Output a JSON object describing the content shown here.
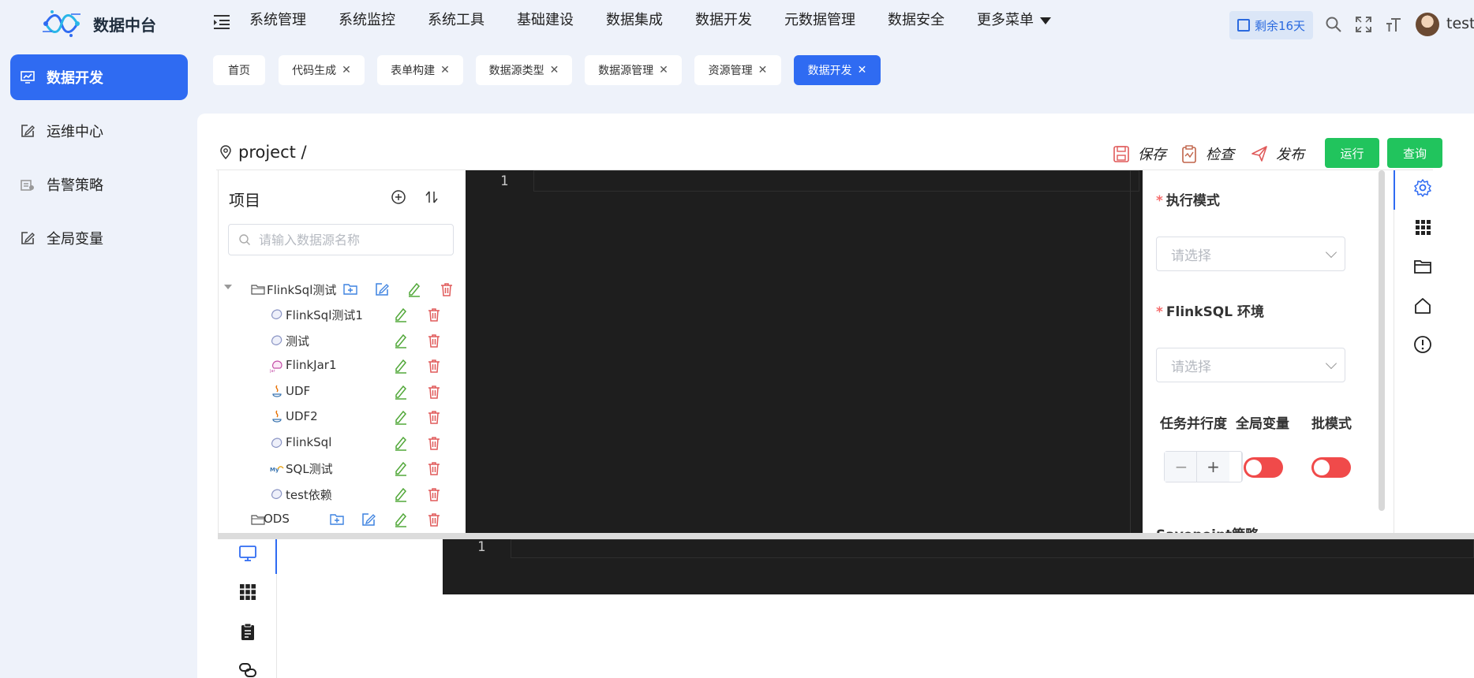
{
  "app": {
    "title": "数据中台"
  },
  "nav": {
    "items": [
      "系统管理",
      "系统监控",
      "系统工具",
      "基础建设",
      "数据集成",
      "数据开发",
      "元数据管理",
      "数据安全"
    ],
    "more": "更多菜单"
  },
  "header": {
    "trial": "剩余16天",
    "user": "test"
  },
  "sidebar": {
    "items": [
      {
        "label": "数据开发",
        "active": true
      },
      {
        "label": "运维中心"
      },
      {
        "label": "告警策略"
      },
      {
        "label": "全局变量"
      }
    ]
  },
  "tabs": [
    {
      "label": "首页",
      "closable": false
    },
    {
      "label": "代码生成",
      "closable": true
    },
    {
      "label": "表单构建",
      "closable": true
    },
    {
      "label": "数据源类型",
      "closable": true
    },
    {
      "label": "数据源管理",
      "closable": true
    },
    {
      "label": "资源管理",
      "closable": true
    },
    {
      "label": "数据开发",
      "closable": true,
      "active": true
    }
  ],
  "breadcrumb": "project /",
  "actions": {
    "save": "保存",
    "check": "检查",
    "publish": "发布",
    "run": "运行",
    "query": "查询"
  },
  "tree": {
    "title": "项目",
    "search_placeholder": "请输入数据源名称",
    "folders": [
      {
        "label": "FlinkSql测试",
        "expanded": true
      },
      {
        "label": "ODS"
      }
    ],
    "nodes": [
      {
        "label": "FlinkSql测试1",
        "type": "flinksql"
      },
      {
        "label": "测试",
        "type": "flinksql"
      },
      {
        "label": "FlinkJar1",
        "type": "flinkjar"
      },
      {
        "label": "UDF",
        "type": "java"
      },
      {
        "label": "UDF2",
        "type": "java"
      },
      {
        "label": "FlinkSql",
        "type": "flinksql"
      },
      {
        "label": "SQL测试",
        "type": "mysql"
      },
      {
        "label": "test依赖",
        "type": "flinksql"
      }
    ]
  },
  "editor": {
    "line_number": "1"
  },
  "bottom_editor": {
    "line_number": "1"
  },
  "config": {
    "exec_mode": {
      "label": "执行模式",
      "placeholder": "请选择"
    },
    "flinksql_env": {
      "label": "FlinkSQL 环境",
      "placeholder": "请选择"
    },
    "parallelism": {
      "label": "任务并行度",
      "minus": "−",
      "plus": "+"
    },
    "global_var": {
      "label": "全局变量",
      "enabled": false
    },
    "batch_mode": {
      "label": "批模式",
      "enabled": false
    },
    "savepoint": {
      "label": "Savepoint策略"
    }
  },
  "colors": {
    "primary": "#2f6bf2",
    "success": "#21c45d",
    "danger": "#f04a4a",
    "edit": "#52a83a",
    "delete": "#e05a5a",
    "folder_add": "#3d82e0"
  }
}
